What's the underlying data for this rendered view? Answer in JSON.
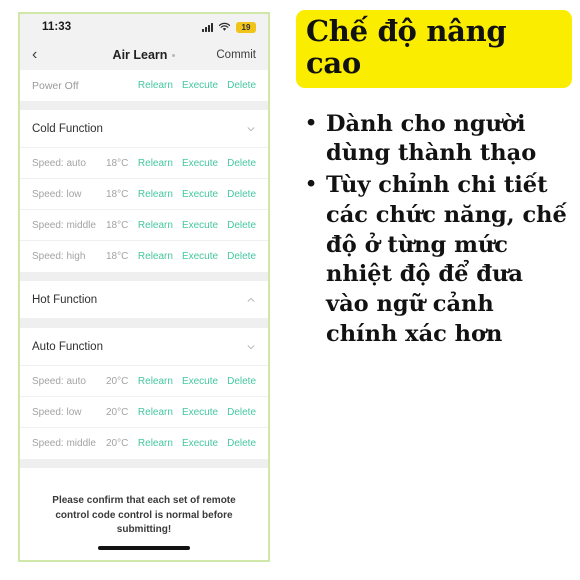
{
  "phone": {
    "status_bar": {
      "time": "11:33",
      "signal_icon": "cellular-signal-icon",
      "wifi_icon": "wifi-icon",
      "battery_level": "19"
    },
    "nav_bar": {
      "back_icon": "chevron-left-icon",
      "title": "Air Learn",
      "commit_label": "Commit"
    },
    "top_row": {
      "label": "Power Off",
      "actions": [
        "Relearn",
        "Execute",
        "Delete"
      ]
    },
    "sections": [
      {
        "title": "Cold Function",
        "chevron": "chevron-down-icon",
        "rows": [
          {
            "speed": "Speed: auto",
            "temp": "18°C",
            "actions": [
              "Relearn",
              "Execute",
              "Delete"
            ]
          },
          {
            "speed": "Speed: low",
            "temp": "18°C",
            "actions": [
              "Relearn",
              "Execute",
              "Delete"
            ]
          },
          {
            "speed": "Speed: middle",
            "temp": "18°C",
            "actions": [
              "Relearn",
              "Execute",
              "Delete"
            ]
          },
          {
            "speed": "Speed: high",
            "temp": "18°C",
            "actions": [
              "Relearn",
              "Execute",
              "Delete"
            ]
          }
        ]
      },
      {
        "title": "Hot Function",
        "chevron": "chevron-up-icon",
        "rows": []
      },
      {
        "title": "Auto Function",
        "chevron": "chevron-down-icon",
        "rows": [
          {
            "speed": "Speed: auto",
            "temp": "20°C",
            "actions": [
              "Relearn",
              "Execute",
              "Delete"
            ]
          },
          {
            "speed": "Speed: low",
            "temp": "20°C",
            "actions": [
              "Relearn",
              "Execute",
              "Delete"
            ]
          },
          {
            "speed": "Speed: middle",
            "temp": "20°C",
            "actions": [
              "Relearn",
              "Execute",
              "Delete"
            ]
          }
        ]
      }
    ],
    "footer_note": "Please confirm that each set of remote control code control is normal before submitting!",
    "home_indicator": "home-indicator"
  },
  "caption": {
    "banner_title": "Chế độ nâng cao",
    "bullets": [
      "Dành cho người dùng thành thạo",
      "Tùy chỉnh chi tiết các chức năng, chế độ ở từng mức nhiệt độ để đưa vào ngữ cảnh chính xác hơn"
    ]
  },
  "colors": {
    "action_green": "#45c7a0",
    "banner_yellow": "#faed00",
    "battery_yellow": "#f0c419",
    "screenshot_border": "#cfe8a8"
  }
}
